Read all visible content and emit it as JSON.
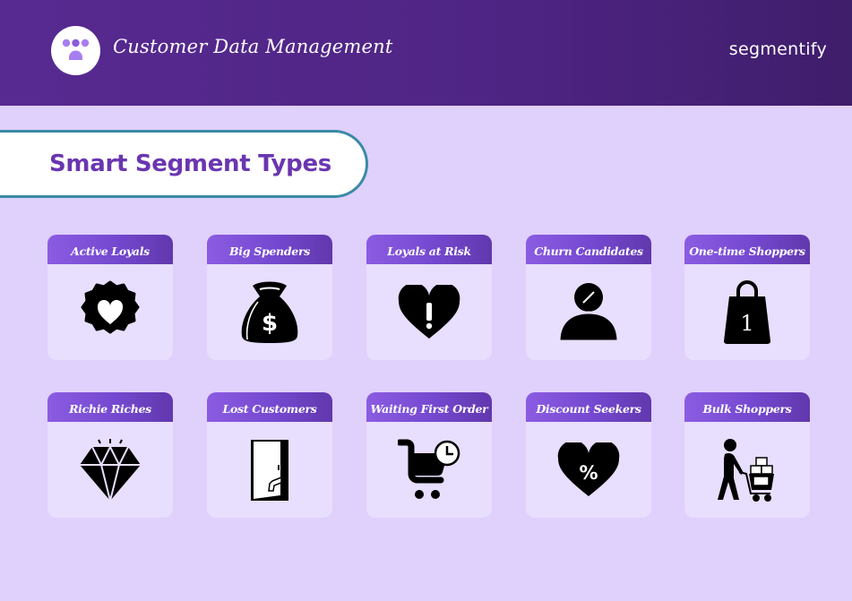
{
  "header": {
    "title": "Customer Data Management",
    "brand": "segmentify",
    "logo_icon": "users-group-icon"
  },
  "section": {
    "title": "Smart Segment Types"
  },
  "colors": {
    "header_bg": "#552a8e",
    "page_bg": "#e0d0fc",
    "card_bg": "#e8defd",
    "card_header": "#7a4fd6",
    "section_title": "#6a36b0",
    "pill_border": "#3a8aa6"
  },
  "segments": [
    {
      "label": "Active Loyals",
      "icon": "badge-heart-icon"
    },
    {
      "label": "Big Spenders",
      "icon": "money-bag-icon"
    },
    {
      "label": "Loyals at Risk",
      "icon": "heart-alert-icon"
    },
    {
      "label": "Churn Candidates",
      "icon": "user-slash-icon"
    },
    {
      "label": "One-time Shoppers",
      "icon": "shopping-bag-one-icon"
    },
    {
      "label": "Richie Riches",
      "icon": "diamond-icon"
    },
    {
      "label": "Lost Customers",
      "icon": "door-exit-icon"
    },
    {
      "label": "Waiting First Order",
      "icon": "cart-clock-icon"
    },
    {
      "label": "Discount Seekers",
      "icon": "heart-percent-icon"
    },
    {
      "label": "Bulk Shoppers",
      "icon": "person-cart-icon"
    }
  ]
}
